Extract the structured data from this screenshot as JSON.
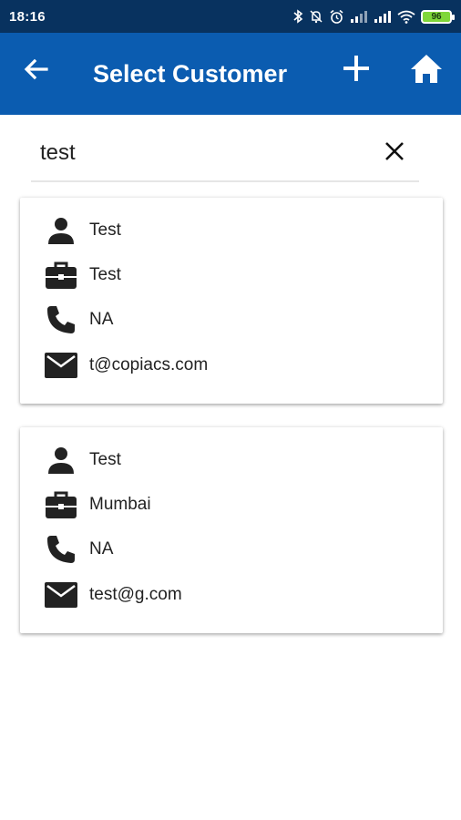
{
  "status_bar": {
    "time": "18:16",
    "battery": "96",
    "icons": [
      "bluetooth-icon",
      "alarm-off-icon",
      "alarm-icon",
      "signal-icon",
      "signal-icon",
      "wifi-icon",
      "battery-icon"
    ]
  },
  "app_bar": {
    "title": "Select Customer",
    "background": "#0b5cb0",
    "icons": [
      "back-arrow-icon",
      "add-icon",
      "home-icon"
    ]
  },
  "search": {
    "value": "test",
    "clear_icon": "close-icon"
  },
  "customers": [
    {
      "name": "Test",
      "company": "Test",
      "phone": "NA",
      "email": "t@copiacs.com"
    },
    {
      "name": "Test",
      "company": "Mumbai",
      "phone": "NA",
      "email": "test@g.com"
    }
  ],
  "row_icons": [
    "person-icon",
    "briefcase-icon",
    "phone-icon",
    "email-icon"
  ]
}
